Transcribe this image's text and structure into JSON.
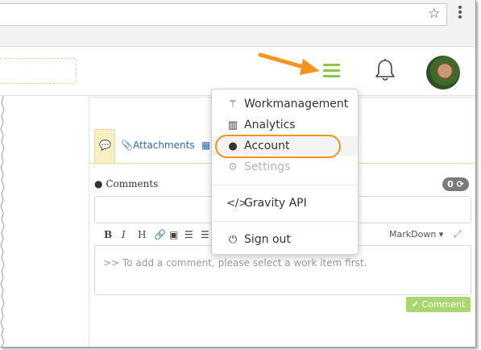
{
  "browser": {
    "star_icon": "star-icon",
    "menu_icon": "kebab-menu-icon"
  },
  "header": {
    "hamburger_color": "#8dc63f",
    "bell_icon": "bell-icon",
    "arrow_color": "#f7941d"
  },
  "tabs": {
    "attachments_label": "Attachments"
  },
  "comments": {
    "label": "Comments",
    "count": "0",
    "toolbar": [
      "B",
      "I",
      "H"
    ],
    "markdown_label": "MarkDown",
    "placeholder": ">> To add a comment, please select a work item first.",
    "submit_label": "Comment"
  },
  "menu": {
    "items": [
      {
        "label": "Workmanagement",
        "icon": "magic-wand-icon"
      },
      {
        "label": "Analytics",
        "icon": "bar-chart-icon"
      },
      {
        "label": "Account",
        "icon": "user-icon"
      },
      {
        "label": "Settings",
        "icon": "gears-icon"
      },
      {
        "label": "Gravity API",
        "icon": "code-icon"
      },
      {
        "label": "Sign out",
        "icon": "power-icon"
      }
    ],
    "highlight_color": "#f0921f"
  }
}
